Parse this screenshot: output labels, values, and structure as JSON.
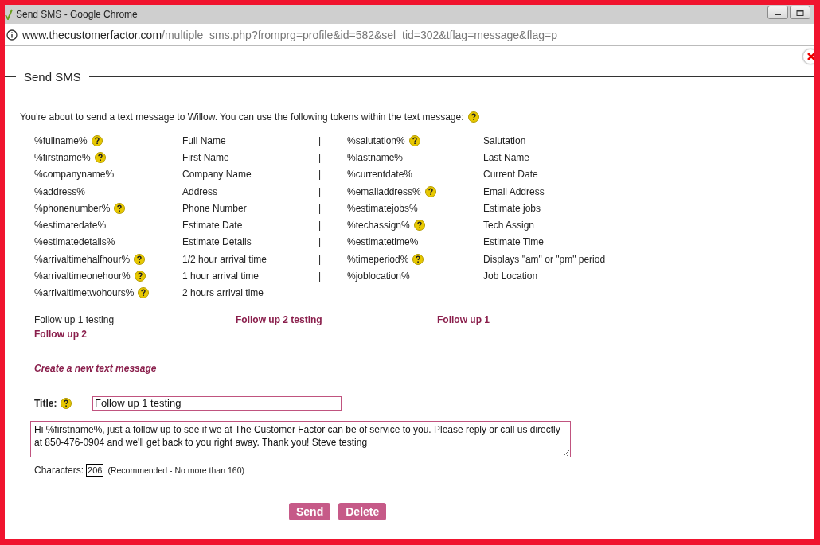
{
  "window": {
    "title": "Send SMS - Google Chrome"
  },
  "address_bar": {
    "domain": "www.thecustomerfactor.com",
    "path": "/multiple_sms.php?fromprg=profile&id=582&sel_tid=302&tflag=message&flag=p"
  },
  "section_title": "Send SMS",
  "intro": "You're about to send a text message to Willow. You can use the following tokens within the text message:",
  "tokens": [
    {
      "token": "%fullname%",
      "help": true,
      "description": "Full Name",
      "separator": "|",
      "token_2": "%salutation%",
      "help_2": true,
      "description_2": "Salutation"
    },
    {
      "token": "%firstname%",
      "help": true,
      "description": "First Name",
      "separator": "|",
      "token_2": "%lastname%",
      "help_2": false,
      "description_2": "Last Name"
    },
    {
      "token": "%companyname%",
      "help": false,
      "description": "Company Name",
      "separator": "|",
      "token_2": "%currentdate%",
      "help_2": false,
      "description_2": "Current Date"
    },
    {
      "token": "%address%",
      "help": false,
      "description": "Address",
      "separator": "|",
      "token_2": "%emailaddress%",
      "help_2": true,
      "description_2": "Email Address"
    },
    {
      "token": "%phonenumber%",
      "help": true,
      "description": "Phone Number",
      "separator": "|",
      "token_2": "%estimatejobs%",
      "help_2": false,
      "description_2": "Estimate jobs"
    },
    {
      "token": "%estimatedate%",
      "help": false,
      "description": "Estimate Date",
      "separator": "|",
      "token_2": "%techassign%",
      "help_2": true,
      "description_2": "Tech Assign"
    },
    {
      "token": "%estimatedetails%",
      "help": false,
      "description": "Estimate Details",
      "separator": "|",
      "token_2": "%estimatetime%",
      "help_2": false,
      "description_2": "Estimate Time"
    },
    {
      "token": "%arrivaltimehalfhour%",
      "help": true,
      "description": "1/2 hour arrival time",
      "separator": "|",
      "token_2": "%timeperiod%",
      "help_2": true,
      "description_2": "Displays \"am\" or \"pm\" period"
    },
    {
      "token": "%arrivaltimeonehour%",
      "help": true,
      "description": "1 hour arrival time",
      "separator": "|",
      "token_2": "%joblocation%",
      "help_2": false,
      "description_2": "Job Location"
    },
    {
      "token": "%arrivaltimetwohours%",
      "help": true,
      "description": "2 hours arrival time"
    }
  ],
  "templates": [
    {
      "label": "Follow up 1 testing",
      "selected": true
    },
    {
      "label": "Follow up 2 testing",
      "selected": false
    },
    {
      "label": "Follow up 1",
      "selected": false
    },
    {
      "label": "Follow up 2",
      "selected": false
    }
  ],
  "create_link": "Create a new text message",
  "form": {
    "title_label": "Title:",
    "title_value": "Follow up 1 testing",
    "message": "Hi %firstname%, just a follow up to see if we at The Customer Factor can be of service to you. Please reply or call us directly at 850-476-0904 and we'll get back to you right away. Thank you! Steve testing",
    "characters_label": "Characters:",
    "characters_count": "206",
    "characters_note": "(Recommended - No more than 160)"
  },
  "buttons": [
    "Send",
    "Delete"
  ]
}
